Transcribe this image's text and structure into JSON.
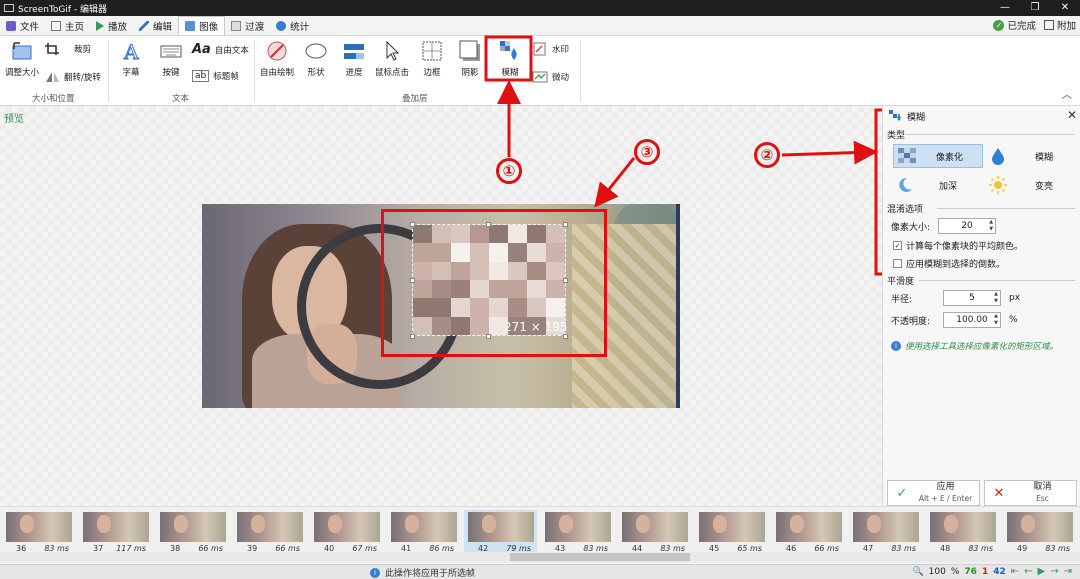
{
  "window": {
    "title": "ScreenToGif - 编辑器",
    "controls": [
      "—",
      "❐",
      "✕"
    ]
  },
  "tabs": [
    {
      "label": "文件"
    },
    {
      "label": "主页"
    },
    {
      "label": "播放"
    },
    {
      "label": "编辑"
    },
    {
      "label": "图像",
      "active": true
    },
    {
      "label": "过渡"
    },
    {
      "label": "统计"
    }
  ],
  "tabs_right": {
    "done": "已完成",
    "attach": "附加"
  },
  "ribbon": {
    "size_group": {
      "resize": "调整大小",
      "crop": "裁剪",
      "flip_rotate": "翻转/旋转",
      "label": "大小和位置"
    },
    "text_group": {
      "caption": "字幕",
      "key_strokes": "按键",
      "free_text": "自由文本",
      "title_frame": "标题帧",
      "label": "文本"
    },
    "overlay_group": {
      "free_drawing": "自由绘制",
      "shapes": "形状",
      "progress": "进度",
      "mouse_clicks": "鼠标点击",
      "border": "边框",
      "shadow": "阴影",
      "obfuscate": "模糊",
      "watermark": "水印",
      "cinemagraph": "微动",
      "label": "叠加层"
    }
  },
  "preview": {
    "label": "预览",
    "selection_size": "271 × 195"
  },
  "annotations": [
    "①",
    "②",
    "③"
  ],
  "panel": {
    "title": "模糊",
    "type_section": "类型",
    "types": [
      {
        "label": "像素化",
        "selected": true
      },
      {
        "label": "模糊"
      },
      {
        "label": "加深"
      },
      {
        "label": "变亮"
      }
    ],
    "pixelate_section": "混淆选项",
    "pixel_size_label": "像素大小:",
    "pixel_size_value": "20",
    "use_average_label": "计算每个像素块的平均颜色。",
    "use_average_checked": true,
    "inverse_label": "应用模糊到选择的倒数。",
    "inverse_checked": false,
    "smooth_section": "平滑度",
    "radius_label": "半径:",
    "radius_value": "5",
    "radius_unit": "px",
    "opacity_label": "不透明度:",
    "opacity_value": "100.00",
    "opacity_unit": "%",
    "info_text": "使用选择工具选择应像素化的矩形区域。",
    "apply_label": "应用",
    "apply_shortcut": "Alt + E / Enter",
    "cancel_label": "取消",
    "cancel_shortcut": "Esc"
  },
  "frames": [
    {
      "num": "36",
      "ms": "83 ms"
    },
    {
      "num": "37",
      "ms": "117 ms"
    },
    {
      "num": "38",
      "ms": "66 ms"
    },
    {
      "num": "39",
      "ms": "66 ms"
    },
    {
      "num": "40",
      "ms": "67 ms"
    },
    {
      "num": "41",
      "ms": "86 ms"
    },
    {
      "num": "42",
      "ms": "79 ms",
      "selected": true
    },
    {
      "num": "43",
      "ms": "83 ms"
    },
    {
      "num": "44",
      "ms": "83 ms"
    },
    {
      "num": "45",
      "ms": "65 ms"
    },
    {
      "num": "46",
      "ms": "66 ms"
    },
    {
      "num": "47",
      "ms": "83 ms"
    },
    {
      "num": "48",
      "ms": "83 ms"
    },
    {
      "num": "49",
      "ms": "83 ms"
    }
  ],
  "status": {
    "message": "此操作将应用于所选帧",
    "zoom": "100",
    "zoom_unit": "%",
    "total_frames": "76",
    "selected_frames": "1",
    "current_frame": "42"
  },
  "colors": {
    "annotation_red": "#e01010",
    "accent_green": "#3a8a55",
    "selection_blue": "#cde1f4"
  }
}
